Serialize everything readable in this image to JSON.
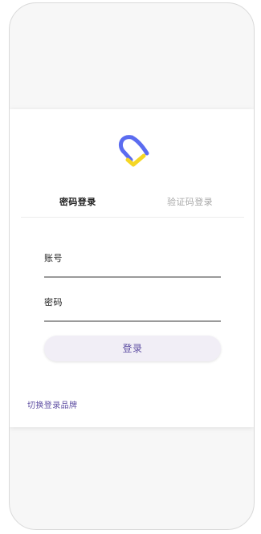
{
  "login": {
    "tabs": [
      "密码登录",
      "验证码登录"
    ],
    "account_label": "账号",
    "password_label": "密码",
    "submit_label": "登录",
    "switch_brand": "切换登录品牌"
  },
  "colors": {
    "logo_blue": "#5b6cf0",
    "logo_yellow": "#f5d624",
    "accent_purple": "#5f4fa3"
  },
  "icons": [
    "brand-logo-icon"
  ]
}
